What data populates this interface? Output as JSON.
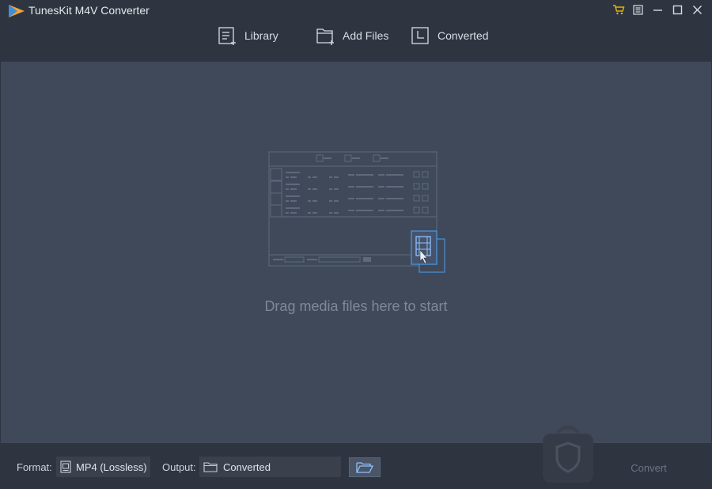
{
  "app": {
    "title": "TunesKit M4V Converter",
    "logo_icon": "tuneskit-logo-icon"
  },
  "window_controls": [
    {
      "name": "cart-button",
      "icon": "cart-icon"
    },
    {
      "name": "menu-button",
      "icon": "menu-icon"
    },
    {
      "name": "minimize-button",
      "icon": "minimize-icon"
    },
    {
      "name": "maximize-button",
      "icon": "maximize-icon"
    },
    {
      "name": "close-button",
      "icon": "close-icon"
    }
  ],
  "toolbar": {
    "library_label": "Library",
    "add_files_label": "Add Files",
    "converted_label": "Converted"
  },
  "main": {
    "drop_hint": "Drag media files here to start",
    "illustration_icon": "drag-drop-illustration-icon"
  },
  "bottom": {
    "format_label": "Format:",
    "format_value": "MP4 (Lossless)",
    "output_label": "Output:",
    "output_value": "Converted",
    "convert_label": "Convert"
  },
  "colors": {
    "titlebar_bg": "#2f3540",
    "main_bg": "#3f4959",
    "accent": "#4a90d9",
    "cart_accent": "#e0b400"
  }
}
